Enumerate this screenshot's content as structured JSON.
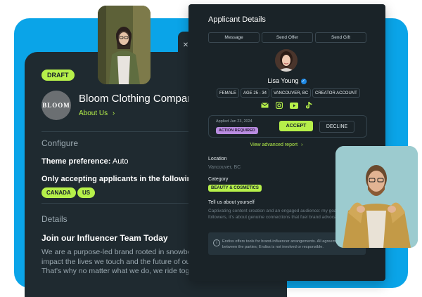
{
  "campaign": {
    "status_badge": "DRAFT",
    "logo_text": "BLOOM",
    "brand_name": "Bloom Clothing Company",
    "about_link": "About Us",
    "configure_title": "Configure",
    "theme_label": "Theme preference:",
    "theme_value": "Auto",
    "accepting_text": "Only accepting applicants in the following countries",
    "countries": [
      "CANADA",
      "US"
    ],
    "details_title": "Details",
    "details_heading": "Join our Influencer Team Today",
    "details_body": "We are a purpose-led brand rooted in snowboarding. Our goal is to positively impact the lives we touch and the future of our people, planet, and sport. That's why no matter what we do, we ride together."
  },
  "applicant": {
    "panel_title": "Applicant Details",
    "actions": [
      "Message",
      "Send Offer",
      "Send Gift"
    ],
    "name": "Lisa Young",
    "attributes": [
      "FEMALE",
      "AGE 25 - 34",
      "VANCOUVER, BC",
      "CREATOR ACCOUNT"
    ],
    "social_icons": [
      "mail-icon",
      "instagram-icon",
      "youtube-icon",
      "tiktok-icon"
    ],
    "applied_date": "Applied Jan 23, 2024",
    "status": "ACTION REQUIRED",
    "accept_label": "ACCEPT",
    "decline_label": "DECLINE",
    "advanced_link": "View advanced report",
    "location_label": "Location",
    "location_value": "Vancouver, BC",
    "category_label": "Category",
    "category_value": "BEAUTY & COSMETICS",
    "tell_label": "Tell us about yourself",
    "tell_body": "Captivating content creation and an engaged audience: my goal isn't just about followers, it's about genuine connections that fuel brand advocacy and impact.",
    "info_text": "Endiss offers tools for brand-influencer arrangements. All agreements are solely between the parties; Endiss is not involved or responsible."
  },
  "colors": {
    "accent": "#b6f04a",
    "brand_blue": "#0aa4e8",
    "card_dark": "#1f2a30",
    "panel_dark": "#1a2328",
    "status_purple": "#b98ce0"
  }
}
